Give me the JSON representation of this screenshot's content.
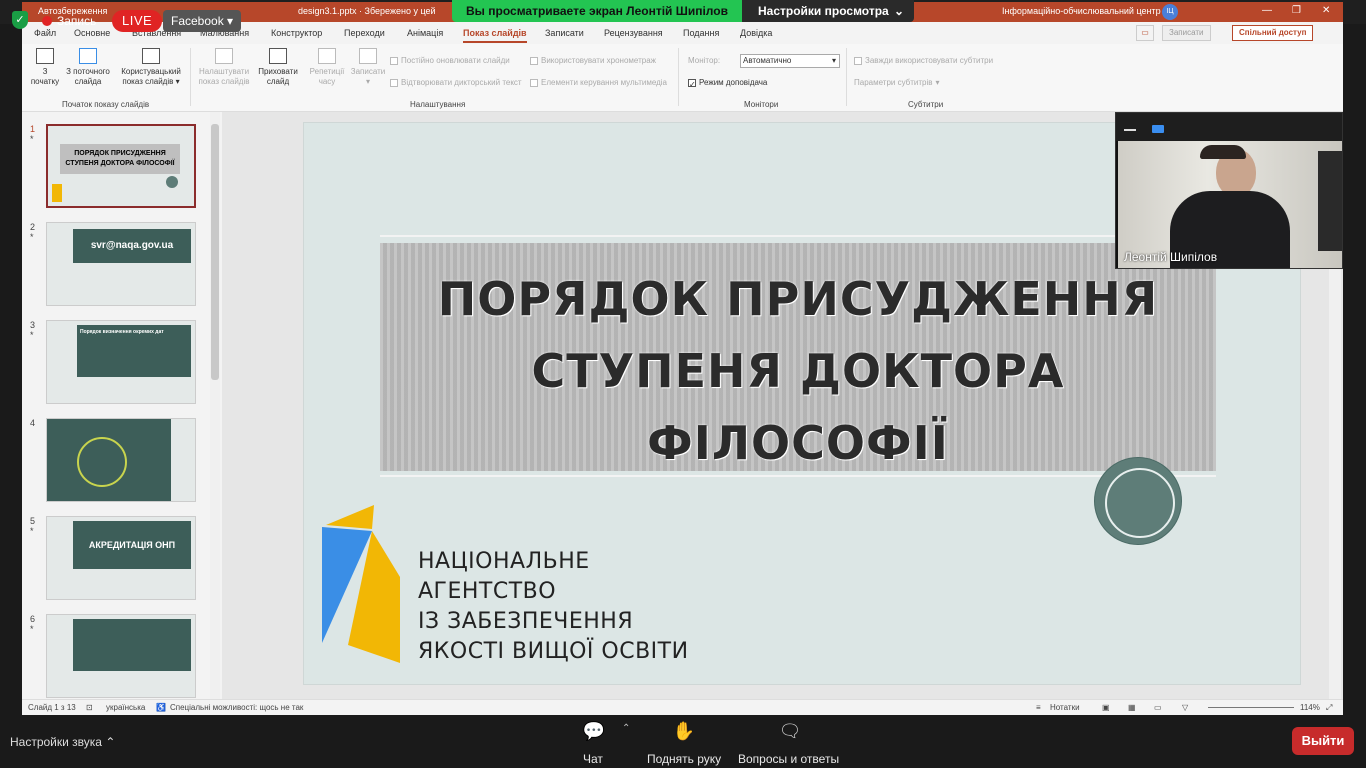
{
  "zoom": {
    "recording_label": "Запись",
    "live_label": "LIVE",
    "facebook_label": "Facebook",
    "viewing_banner": "Вы просматриваете экран Леонтій Шипілов",
    "view_settings": "Настройки просмотра",
    "audio_settings": "Настройки звука",
    "chat": "Чат",
    "raise_hand": "Поднять руку",
    "qa": "Вопросы и ответы",
    "leave": "Выйти"
  },
  "ppt": {
    "autosave": "Автозбереження",
    "filename": "design3.1.pptx",
    "saved_status": "Збережено у цей",
    "org": "Інформаційно-обчислювальний центр",
    "user_initials": "ІЦ",
    "menu": [
      "Файл",
      "Основне",
      "Вставлення",
      "Малювання",
      "Конструктор",
      "Переходи",
      "Анімація",
      "Показ слайдів",
      "Записати",
      "Рецензування",
      "Подання",
      "Довідка"
    ],
    "save_button": "Записати",
    "share_button": "Спільний доступ",
    "ribbon": {
      "from_start": [
        "З",
        "початку"
      ],
      "from_current": [
        "З поточного",
        "слайда"
      ],
      "custom_show": [
        "Користувацький",
        "показ слайдів"
      ],
      "group_start": "Початок показу слайдів",
      "setup_show": [
        "Налаштувати",
        "показ слайдів"
      ],
      "hide_slide": [
        "Приховати",
        "слайд"
      ],
      "rehearse": [
        "Репетиції",
        "часу"
      ],
      "record": [
        "Записати",
        ""
      ],
      "chk_update": "Постійно оновлювати слайди",
      "chk_timings": "Використовувати хронометраж",
      "chk_narration": "Відтворювати дикторський текст",
      "chk_media": "Елементи керування мультимедіа",
      "group_setup": "Налаштування",
      "monitor_label": "Монітор:",
      "monitor_value": "Автоматично",
      "presenter_view": "Режим доповідача",
      "group_monitors": "Монітори",
      "chk_subtitles": "Завжди використовувати субтитри",
      "subtitle_settings": "Параметри субтитрів",
      "group_subtitles": "Субтитри"
    },
    "thumbs": [
      {
        "num": "1",
        "text": "ПОРЯДОК ПРИСУДЖЕННЯ СТУПЕНЯ ДОКТОРА ФІЛОСОФІЇ"
      },
      {
        "num": "2",
        "text": "svr@naqa.gov.ua"
      },
      {
        "num": "3",
        "text": "Порядок визначення окремих дат"
      },
      {
        "num": "4",
        "text": ""
      },
      {
        "num": "5",
        "text": "АКРЕДИТАЦІЯ ОНП"
      },
      {
        "num": "6",
        "text": ""
      }
    ],
    "slide": {
      "title_line1": "ПОРЯДОК ПРИСУДЖЕННЯ",
      "title_line2": "СТУПЕНЯ ДОКТОРА ФІЛОСОФІЇ",
      "agency": [
        "НАЦІОНАЛЬНЕ",
        "АГЕНТСТВО",
        "ІЗ ЗАБЕЗПЕЧЕННЯ",
        "ЯКОСТІ ВИЩОЇ ОСВІТИ"
      ]
    },
    "status": {
      "slide_count": "Слайд 1 з 13",
      "language": "українська",
      "accessibility": "Спеціальні можливості: щось не так",
      "notes": "Нотатки",
      "zoom": "114%"
    }
  },
  "presenter": {
    "name": "Леонтій Шипілов"
  },
  "colors": {
    "ppt_accent": "#b7472a",
    "slide_green": "#3d5e59",
    "logo_blue": "#3a8ee6",
    "logo_yellow": "#f2b705",
    "zoom_green": "#23c552",
    "live_red": "#e02424"
  }
}
